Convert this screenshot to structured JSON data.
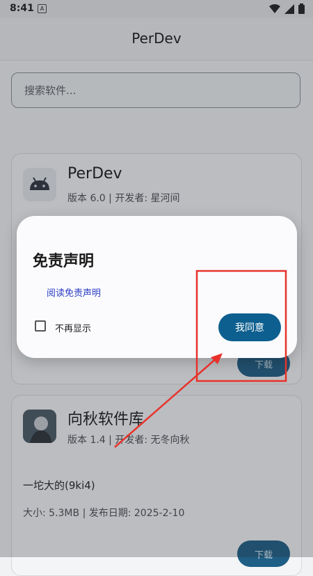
{
  "status_bar": {
    "time": "8:41",
    "notif_badge": "A"
  },
  "app_bar": {
    "title": "PerDev"
  },
  "search": {
    "placeholder": "搜索软件..."
  },
  "apps": [
    {
      "name": "PerDev",
      "meta": "版本 6.0 | 开发者: 星河间",
      "download_label": "下载"
    },
    {
      "name": "向秋软件库",
      "meta": "版本 1.4 | 开发者: 无冬向秋",
      "description": "一坨大的(9ki4)",
      "info": "大小: 5.3MB | 发布日期: 2025-2-10",
      "download_label": "下载"
    }
  ],
  "dialog": {
    "title": "免责声明",
    "link": "阅读免责声明",
    "checkbox_label": "不再显示",
    "agree_label": "我同意"
  },
  "colors": {
    "accent": "#0d5f8f",
    "annotation": "#e8322b",
    "link": "#2b3dc4"
  }
}
